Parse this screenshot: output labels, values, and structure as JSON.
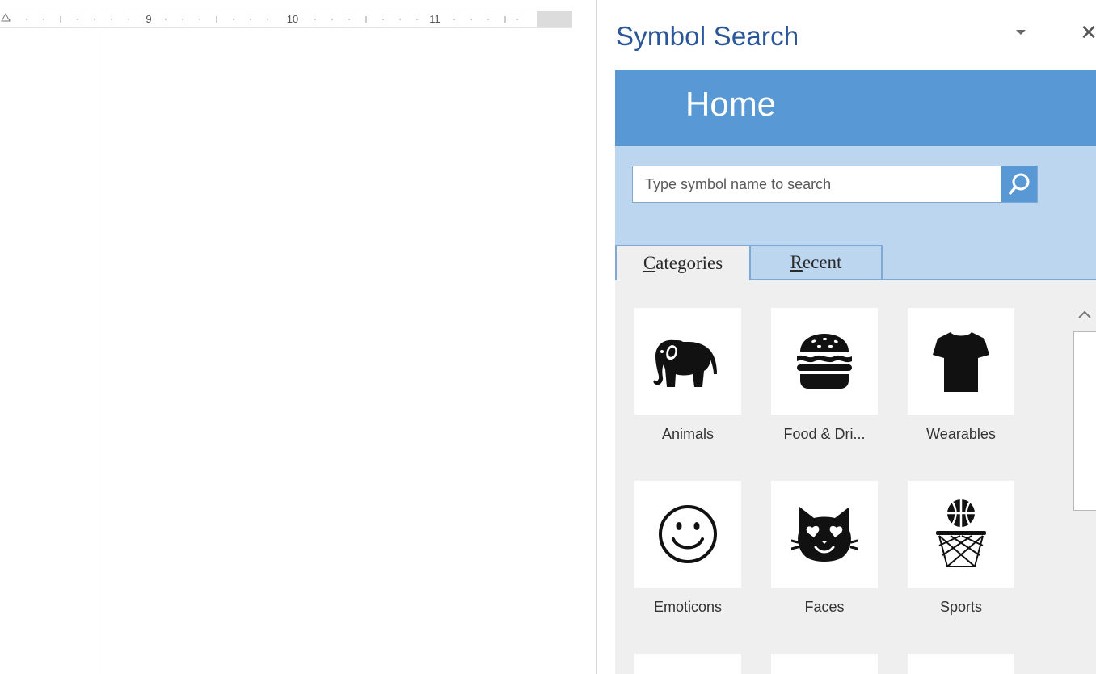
{
  "ruler": {
    "numbers": [
      "9",
      "10",
      "11"
    ]
  },
  "pane": {
    "title": "Symbol Search",
    "close_glyph": "✕",
    "options_icon": "chevron-down-icon"
  },
  "addin": {
    "header_title": "Home",
    "search": {
      "placeholder": "Type symbol name to search",
      "value": "",
      "icon": "search-icon"
    },
    "tabs": [
      {
        "first": "C",
        "rest": "ategories",
        "active": true
      },
      {
        "first": "R",
        "rest": "ecent",
        "active": false
      }
    ],
    "categories": [
      {
        "label": "Animals",
        "icon": "elephant-icon"
      },
      {
        "label": "Food & Dri...",
        "icon": "burger-icon"
      },
      {
        "label": "Wearables",
        "icon": "tshirt-icon"
      },
      {
        "label": "Emoticons",
        "icon": "smiley-icon"
      },
      {
        "label": "Faces",
        "icon": "cat-face-icon"
      },
      {
        "label": "Sports",
        "icon": "basketball-hoop-icon"
      }
    ],
    "colors": {
      "header": "#5898d4",
      "search_band": "#bcd6ef",
      "title": "#2b579a"
    }
  }
}
